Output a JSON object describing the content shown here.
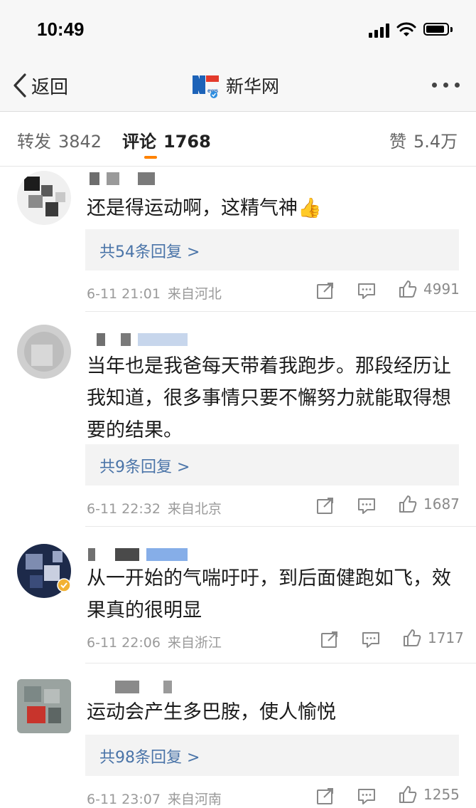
{
  "status_bar": {
    "time": "10:49"
  },
  "nav": {
    "back_label": "返回",
    "title": "新华网",
    "logo_text": "新华网"
  },
  "tabs": [
    {
      "label": "转发",
      "count": "3842"
    },
    {
      "label": "评论",
      "count": "1768"
    },
    {
      "label": "赞",
      "count": "5.4万"
    }
  ],
  "comments": [
    {
      "text": "还是得运动啊，这精气神👍",
      "reply": "共54条回复 >",
      "date": "6-11 21:01",
      "source": "来自河北",
      "likes": "4991"
    },
    {
      "text": "当年也是我爸每天带着我跑步。那段经历让我知道，很多事情只要不懈努力就能取得想要的结果。",
      "reply": "共9条回复 >",
      "date": "6-11 22:32",
      "source": "来自北京",
      "likes": "1687"
    },
    {
      "text": "从一开始的气喘吁吁，到后面健跑如飞，效果真的很明显",
      "date": "6-11 22:06",
      "source": "来自浙江",
      "likes": "1717"
    },
    {
      "text": "运动会产生多巴胺，使人愉悦",
      "reply": "共98条回复 >",
      "date": "6-11 23:07",
      "source": "来自河南",
      "likes": "1255"
    }
  ],
  "icons": {
    "repost": "share-icon",
    "comment": "comment-icon",
    "like": "thumbs-up-icon"
  },
  "colors": {
    "accent": "#ff8200",
    "link": "#4a74a8"
  }
}
